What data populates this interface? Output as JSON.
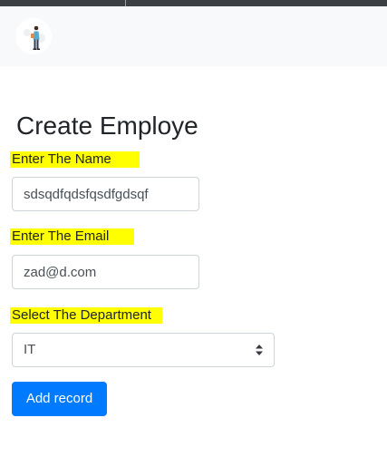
{
  "page": {
    "title": "Create Employe"
  },
  "form": {
    "name_label": "Enter The Name",
    "name_value": "sdsqdfqdsfqsdfgdsqf",
    "email_label": "Enter The Email",
    "email_value": "zad@d.com",
    "department_label": "Select The Department",
    "department_selected": "IT",
    "submit_label": "Add record"
  },
  "icons": {
    "brand": "person-with-suitcase-logo-icon",
    "select_caret": "up-down-caret-icon"
  },
  "colors": {
    "navbar_bg": "#f8f9fa",
    "label_highlight": "#ffff00",
    "primary_button": "#007bff",
    "text": "#212529",
    "input_border": "#ced4da"
  }
}
